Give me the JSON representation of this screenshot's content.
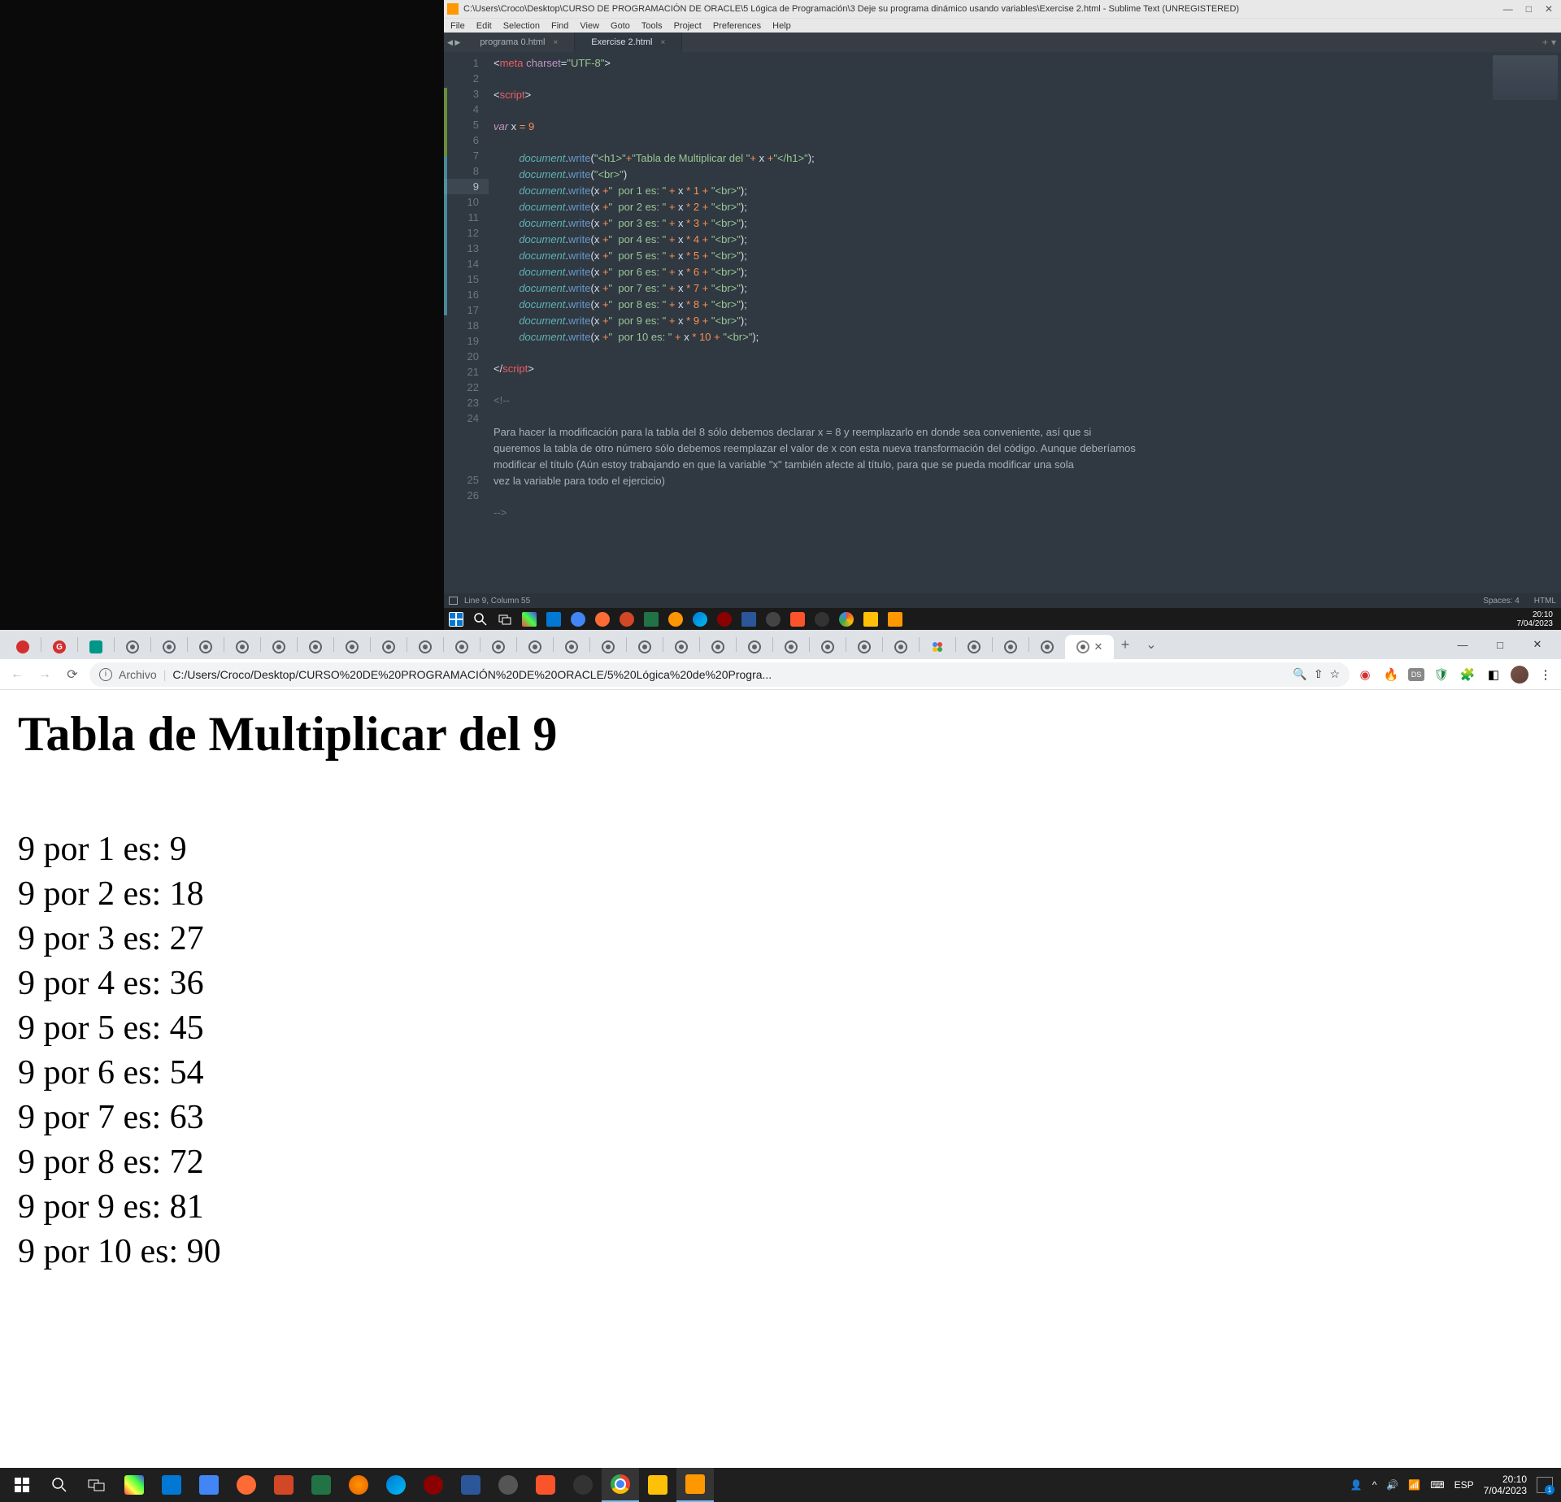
{
  "sublime": {
    "title": "C:\\Users\\Croco\\Desktop\\CURSO DE PROGRAMACIÓN DE ORACLE\\5 Lógica de Programación\\3 Deje su programa dinámico usando variables\\Exercise 2.html - Sublime Text (UNREGISTERED)",
    "menu": [
      "File",
      "Edit",
      "Selection",
      "Find",
      "View",
      "Goto",
      "Tools",
      "Project",
      "Preferences",
      "Help"
    ],
    "tabs": [
      {
        "label": "programa 0.html",
        "active": false
      },
      {
        "label": "Exercise 2.html",
        "active": true
      }
    ],
    "line_numbers": [
      "1",
      "2",
      "3",
      "4",
      "5",
      "6",
      "7",
      "8",
      "9",
      "10",
      "11",
      "12",
      "13",
      "14",
      "15",
      "16",
      "17",
      "18",
      "19",
      "20",
      "21",
      "22",
      "23",
      "24",
      "25",
      "26"
    ],
    "highlighted_line": 9,
    "code": {
      "l1_a": "<",
      "l1_b": "meta ",
      "l1_c": "charset",
      "l1_d": "=",
      "l1_e": "\"UTF-8\"",
      "l1_f": ">",
      "l3_a": "<",
      "l3_b": "script",
      "l3_c": ">",
      "l5_a": "var ",
      "l5_b": "x ",
      "l5_c": "= ",
      "l5_d": "9",
      "l7_a": "document",
      "l7_b": ".",
      "l7_c": "write",
      "l7_d": "(",
      "l7_e": "\"<h1>\"",
      "l7_f": "+",
      "l7_g": "\"Tabla de Multiplicar del \"",
      "l7_h": "+ ",
      "l7_i": "x ",
      "l7_j": "+",
      "l7_k": "\"</h1>\"",
      "l7_l": ");",
      "l8_a": "document",
      "l8_b": ".",
      "l8_c": "write",
      "l8_d": "(",
      "l8_e": "\"<br>\"",
      "l8_f": ")",
      "dw": "document",
      "dot": ".",
      "wr": "write",
      "op": "(",
      "cx": "x ",
      "plus": "+",
      "cp": ");",
      "l9s": "\"  por 1 es: \" ",
      "l9p": "+ ",
      "l9x": "x ",
      "l9m": "* ",
      "l9n": "1 ",
      "l9b": "+ ",
      "l9br": "\"<br>\"",
      "l10s": "\"  por 2 es: \" ",
      "l10n": "2 ",
      "l11s": "\"  por 3 es: \" ",
      "l11n": "3 ",
      "l12s": "\"  por 4 es: \" ",
      "l12n": "4 ",
      "l13s": "\"  por 5 es: \" ",
      "l13n": "5 ",
      "l14s": "\"  por 6 es: \" ",
      "l14n": "6 ",
      "l15s": "\"  por 7 es: \" ",
      "l15n": "7 ",
      "l16s": "\"  por 8 es: \" ",
      "l16n": "8 ",
      "l17s": "\"  por 9 es: \" ",
      "l17n": "9 ",
      "l18s": "\"  por 10 es: \" ",
      "l18n": "10 ",
      "l20_a": "</",
      "l20_b": "script",
      "l20_c": ">",
      "l22": "<!--",
      "l24": "Para hacer la modificación para la tabla del 8 sólo debemos declarar x = 8 y reemplazarlo en donde sea conveniente, así que si\nqueremos la tabla de otro número sólo debemos reemplazar el valor de x con esta nueva transformación del código. Aunque deberíamos\nmodificar el título (Aún estoy trabajando en que la variable \"x\" también afecte al título, para que se pueda modificar una sola\nvez la variable para todo el ejercicio)",
      "l26": "-->"
    },
    "status_left": "Line 9, Column 55",
    "status_spaces": "Spaces: 4",
    "status_lang": "HTML"
  },
  "upper_taskbar": {
    "time": "20:10",
    "date": "7/04/2023"
  },
  "chrome": {
    "tab_count_generic": 27,
    "omnibox_label": "Archivo",
    "omnibox_url": "C:/Users/Croco/Desktop/CURSO%20DE%20PROGRAMACIÓN%20DE%20ORACLE/5%20Lógica%20de%20Progra...",
    "page_title": "Tabla de Multiplicar del 9",
    "rows": [
      "9 por 1 es: 9",
      "9 por 2 es: 18",
      "9 por 3 es: 27",
      "9 por 4 es: 36",
      "9 por 5 es: 45",
      "9 por 6 es: 54",
      "9 por 7 es: 63",
      "9 por 8 es: 72",
      "9 por 9 es: 81",
      "9 por 10 es: 90"
    ]
  },
  "bottom_taskbar": {
    "lang": "ESP",
    "time": "20:10",
    "date": "7/04/2023"
  }
}
